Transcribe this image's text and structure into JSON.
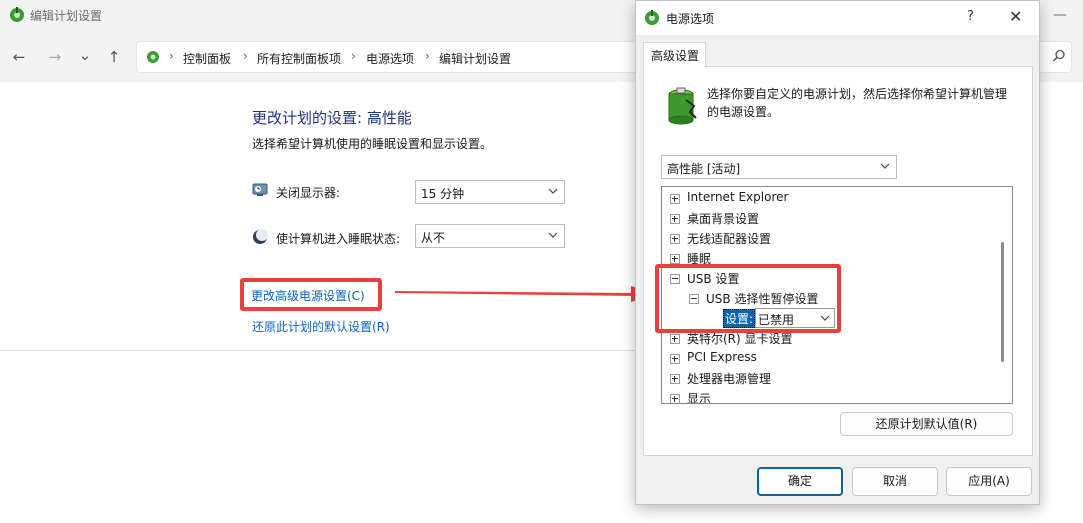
{
  "window": {
    "title": "编辑计划设置",
    "minimize_glyph": "—"
  },
  "nav": {
    "back_icon": "←",
    "forward_icon": "→",
    "recent_icon": "⌄",
    "up_icon": "↑",
    "breadcrumbs": [
      "控制面板",
      "所有控制面板项",
      "电源选项",
      "编辑计划设置"
    ],
    "separator": "›",
    "search_icon": "search-icon"
  },
  "main": {
    "title": "更改计划的设置: 高性能",
    "subtitle": "选择希望计算机使用的睡眠设置和显示设置。",
    "display_off": {
      "label": "关闭显示器:",
      "value": "15 分钟"
    },
    "sleep": {
      "label": "使计算机进入睡眠状态:",
      "value": "从不"
    },
    "advanced_link": "更改高级电源设置(C)",
    "restore_link": "还原此计划的默认设置(R)"
  },
  "dialog": {
    "title": "电源选项",
    "help": "?",
    "close": "✕",
    "tab": "高级设置",
    "description": "选择你要自定义的电源计划，然后选择你希望计算机管理的电源设置。",
    "plan": "高性能 [活动]",
    "tree": [
      {
        "label": "Internet Explorer",
        "expanded": false
      },
      {
        "label": "桌面背景设置",
        "expanded": false
      },
      {
        "label": "无线适配器设置",
        "expanded": false
      },
      {
        "label": "睡眠",
        "expanded": false
      },
      {
        "label": "USB 设置",
        "expanded": true
      },
      {
        "label": "USB 选择性暂停设置",
        "expanded": true
      },
      {
        "label": "英特尔(R) 显卡设置",
        "expanded": false
      },
      {
        "label": "PCI Express",
        "expanded": false
      },
      {
        "label": "处理器电源管理",
        "expanded": false
      },
      {
        "label": "显示",
        "expanded": false
      }
    ],
    "setting": {
      "label": "设置:",
      "value": "已禁用"
    },
    "restore_button": "还原计划默认值(R)",
    "ok": "确定",
    "cancel": "取消",
    "apply": "应用(A)"
  },
  "colors": {
    "annotation": "#e8403d",
    "link": "#0b66c3",
    "title": "#1e3287",
    "selection": "#0a64ad"
  }
}
